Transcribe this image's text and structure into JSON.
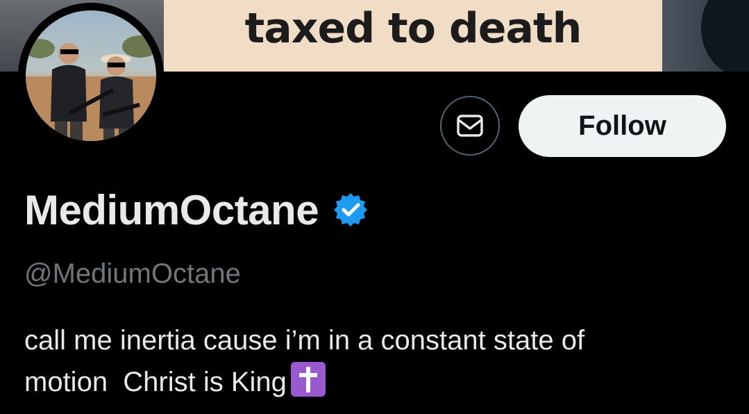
{
  "banner": {
    "text": "taxed to death"
  },
  "profile": {
    "display_name": "MediumOctane",
    "handle": "@MediumOctane",
    "verified": true,
    "bio_line1": "call me inertia cause i’m in a constant state of",
    "bio_line2": "motion  Christ is King",
    "bio_emoji": "latin-cross-emoji"
  },
  "actions": {
    "message_icon": "envelope-icon",
    "follow_label": "Follow"
  },
  "colors": {
    "background": "#000000",
    "primary_text": "#e7e9ea",
    "secondary_text": "#71767b",
    "verified_blue": "#1d9bf0",
    "follow_bg": "#eff3f4",
    "emoji_purple": "#9b59d0"
  }
}
